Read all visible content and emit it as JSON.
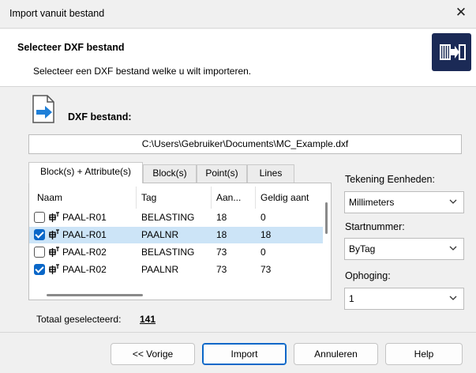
{
  "window": {
    "title": "Import vanuit bestand",
    "close_glyph": "✕"
  },
  "header": {
    "title": "Selecteer DXF bestand",
    "subtitle": "Selecteer een DXF bestand welke u wilt importeren.",
    "icon": "import-file-icon"
  },
  "file": {
    "label": "DXF bestand:",
    "path": "C:\\Users\\Gebruiker\\Documents\\MC_Example.dxf",
    "icon": "file-import-icon"
  },
  "tabs": [
    {
      "label": "Block(s) + Attribute(s)",
      "active": true
    },
    {
      "label": "Block(s)",
      "active": false
    },
    {
      "label": "Point(s)",
      "active": false
    },
    {
      "label": "Lines",
      "active": false
    }
  ],
  "table": {
    "columns": [
      "Naam",
      "Tag",
      "Aan...",
      "Geldig aant"
    ],
    "rows": [
      {
        "checked": false,
        "selected": false,
        "naam": "PAAL-R01",
        "tag": "BELASTING",
        "aan": "18",
        "geldig": "0"
      },
      {
        "checked": true,
        "selected": true,
        "naam": "PAAL-R01",
        "tag": "PAALNR",
        "aan": "18",
        "geldig": "18"
      },
      {
        "checked": false,
        "selected": false,
        "naam": "PAAL-R02",
        "tag": "BELASTING",
        "aan": "73",
        "geldig": "0"
      },
      {
        "checked": true,
        "selected": false,
        "naam": "PAAL-R02",
        "tag": "PAALNR",
        "aan": "73",
        "geldig": "73"
      }
    ]
  },
  "side": {
    "units_label": "Tekening Eenheden:",
    "units_value": "Millimeters",
    "start_label": "Startnummer:",
    "start_value": "ByTag",
    "incr_label": "Ophoging:",
    "incr_value": "1"
  },
  "total": {
    "label": "Totaal geselecteerd:",
    "value": "141"
  },
  "buttons": {
    "prev": "<< Vorige",
    "import": "Import",
    "cancel": "Annuleren",
    "help": "Help"
  },
  "colors": {
    "accent": "#0a67c8",
    "selection": "#cce4f7",
    "header_icon_bg": "#1b2a56"
  }
}
